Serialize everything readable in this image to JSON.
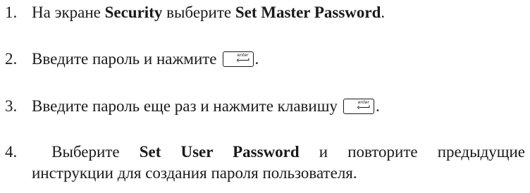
{
  "steps": [
    {
      "number": "1.",
      "parts": {
        "t1": "На экране ",
        "b1": "Security",
        "t2": " выберите ",
        "b2": "Set Master Password",
        "t3": "."
      }
    },
    {
      "number": "2.",
      "parts": {
        "t1": "Введите пароль и нажмите",
        "key": "enter",
        "t2": "."
      }
    },
    {
      "number": "3.",
      "parts": {
        "t1": "Введите пароль еще раз и нажмите клавишу",
        "key": "enter",
        "t2": "."
      }
    },
    {
      "number": "4.",
      "parts": {
        "t1": "Выберите",
        "b1": "Set User Password",
        "t2": "и повторите предыдущие",
        "t3": "инструкции для создания пароля пользователя."
      }
    }
  ],
  "icons": {
    "enter_key": "enter-key-icon"
  }
}
